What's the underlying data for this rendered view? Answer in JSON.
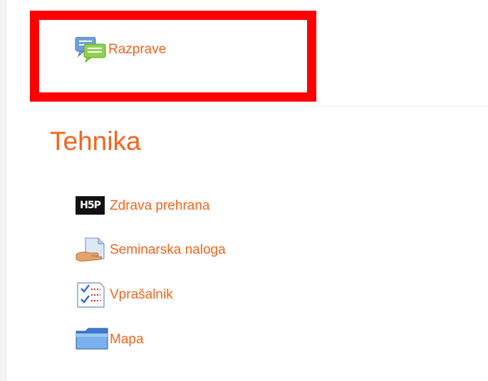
{
  "forum": {
    "label": "Razprave",
    "icon": "forum-chat-bubbles-icon"
  },
  "section": {
    "title": "Tehnika",
    "activities": [
      {
        "label": "Zdrava prehrana",
        "icon": "h5p-icon"
      },
      {
        "label": "Seminarska naloga",
        "icon": "assignment-icon"
      },
      {
        "label": "Vprašalnik",
        "icon": "questionnaire-icon"
      },
      {
        "label": "Mapa",
        "icon": "folder-icon"
      }
    ]
  },
  "h5p_badge_text": "H5P",
  "colors": {
    "link": "#f7631b",
    "highlight_border": "#ff0000"
  }
}
